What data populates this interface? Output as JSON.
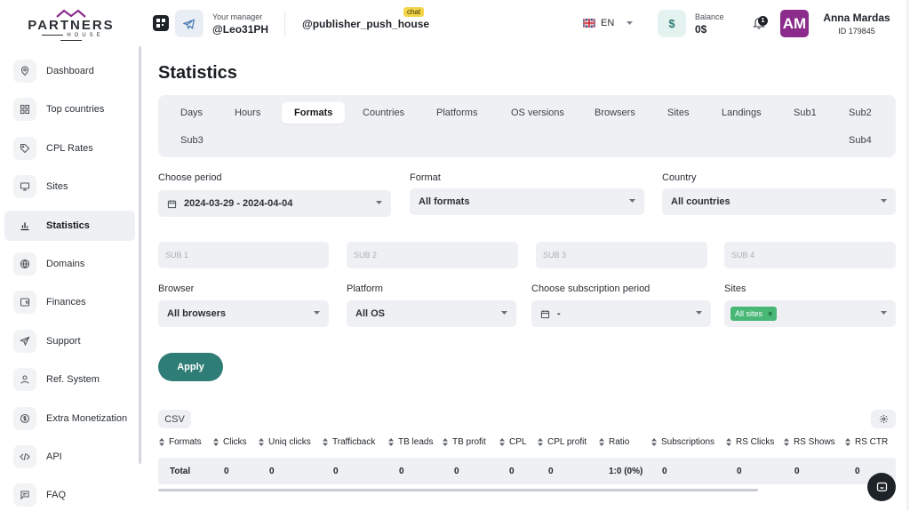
{
  "logo": {
    "title": "PARTNERS",
    "subtitle": "HOUSE"
  },
  "sidebar": {
    "items": [
      {
        "label": "Dashboard",
        "icon": "location-pin-icon"
      },
      {
        "label": "Top countries",
        "icon": "grid-icon"
      },
      {
        "label": "CPL Rates",
        "icon": "tag-icon"
      },
      {
        "label": "Sites",
        "icon": "monitor-icon"
      },
      {
        "label": "Statistics",
        "icon": "bar-chart-icon",
        "active": true
      },
      {
        "label": "Domains",
        "icon": "globe-icon"
      },
      {
        "label": "Finances",
        "icon": "wallet-icon"
      },
      {
        "label": "Support",
        "icon": "send-icon"
      },
      {
        "label": "Ref. System",
        "icon": "user-icon"
      },
      {
        "label": "Extra Monetization",
        "icon": "dollar-coin-icon"
      },
      {
        "label": "API",
        "icon": "code-icon"
      },
      {
        "label": "FAQ",
        "icon": "message-square-icon"
      }
    ]
  },
  "header": {
    "manager_caption": "Your manager",
    "manager_name": "@Leo31PH",
    "chat_name": "@publisher_push_house",
    "chat_badge": "chat",
    "language": "EN",
    "balance_symbol": "$",
    "balance_caption": "Balance",
    "balance_value": "0$",
    "notification_count": "1",
    "avatar_initials": "AM",
    "user_name": "Anna Mardas",
    "user_id": "ID 179845"
  },
  "page": {
    "title": "Statistics"
  },
  "tabs": [
    {
      "label": "Days"
    },
    {
      "label": "Hours"
    },
    {
      "label": "Formats",
      "active": true
    },
    {
      "label": "Countries"
    },
    {
      "label": "Platforms"
    },
    {
      "label": "OS versions"
    },
    {
      "label": "Browsers"
    },
    {
      "label": "Sites"
    },
    {
      "label": "Landings"
    },
    {
      "label": "Sub1"
    },
    {
      "label": "Sub2"
    },
    {
      "label": "Sub3"
    },
    {
      "label": "Sub4"
    }
  ],
  "filters": {
    "period": {
      "label": "Choose period",
      "value": "2024-03-29 - 2024-04-04"
    },
    "format": {
      "label": "Format",
      "value": "All formats"
    },
    "country": {
      "label": "Country",
      "value": "All countries"
    },
    "sub1": {
      "placeholder": "SUB 1"
    },
    "sub2": {
      "placeholder": "SUB 2"
    },
    "sub3": {
      "placeholder": "SUB 3"
    },
    "sub4": {
      "placeholder": "SUB 4"
    },
    "browser": {
      "label": "Browser",
      "value": "All browsers"
    },
    "platform": {
      "label": "Platform",
      "value": "All OS"
    },
    "subscription": {
      "label": "Choose subscription period",
      "value": "-"
    },
    "sites": {
      "label": "Sites",
      "chip": "All sites",
      "chip_close": "×"
    }
  },
  "actions": {
    "apply": "Apply",
    "csv": "CSV"
  },
  "table": {
    "columns": [
      "Formats",
      "Clicks",
      "Uniq clicks",
      "Trafficback",
      "TB leads",
      "TB profit",
      "CPL",
      "CPL profit",
      "Ratio",
      "Subscriptions",
      "RS Clicks",
      "RS Shows",
      "RS CTR"
    ],
    "total_row": [
      "Total",
      "0",
      "0",
      "0",
      "0",
      "0",
      "0",
      "0",
      "1:0 (0%)",
      "0",
      "0",
      "0",
      "0"
    ]
  },
  "colors": {
    "accent": "#2e7d76",
    "chip": "#49b877",
    "avatar": "#8b2c8c",
    "badge": "#f3d54a",
    "panel": "#eef0f3"
  }
}
